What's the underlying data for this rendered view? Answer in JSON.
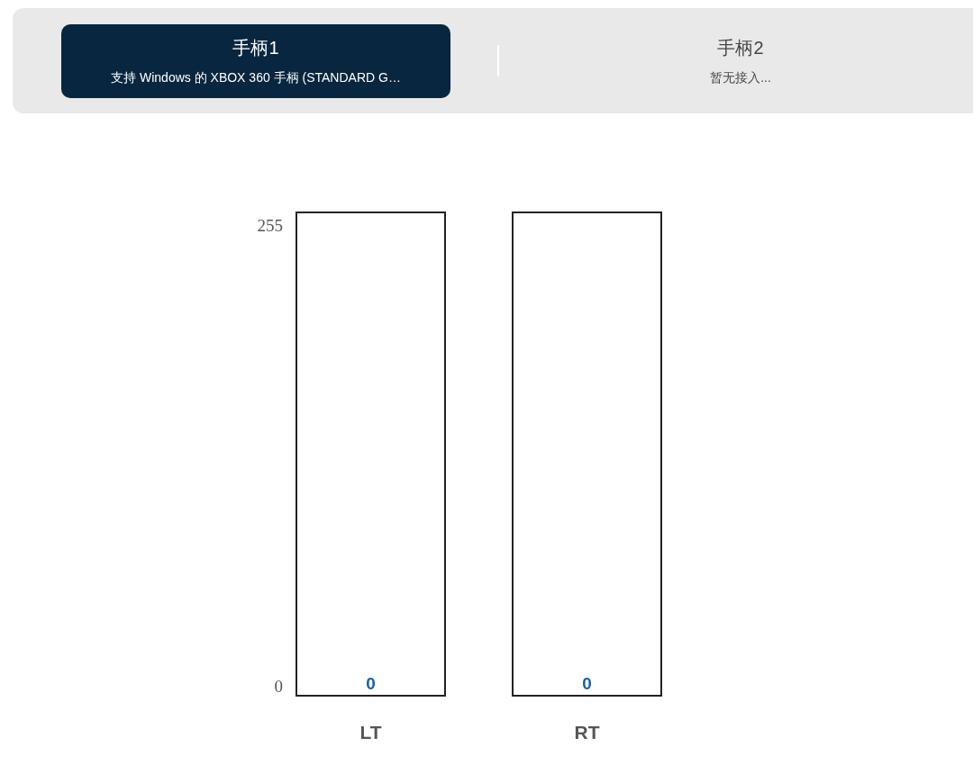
{
  "tabs": [
    {
      "title": "手柄1",
      "subtitle": "支持 Windows 的 XBOX 360 手柄 (STANDARD G…",
      "selected": true
    },
    {
      "title": "手柄2",
      "subtitle": "暂无接入...",
      "selected": false
    }
  ],
  "scale": {
    "max": "255",
    "min": "0"
  },
  "triggers": [
    {
      "label": "LT",
      "reading": "0"
    },
    {
      "label": "RT",
      "reading": "0"
    }
  ]
}
